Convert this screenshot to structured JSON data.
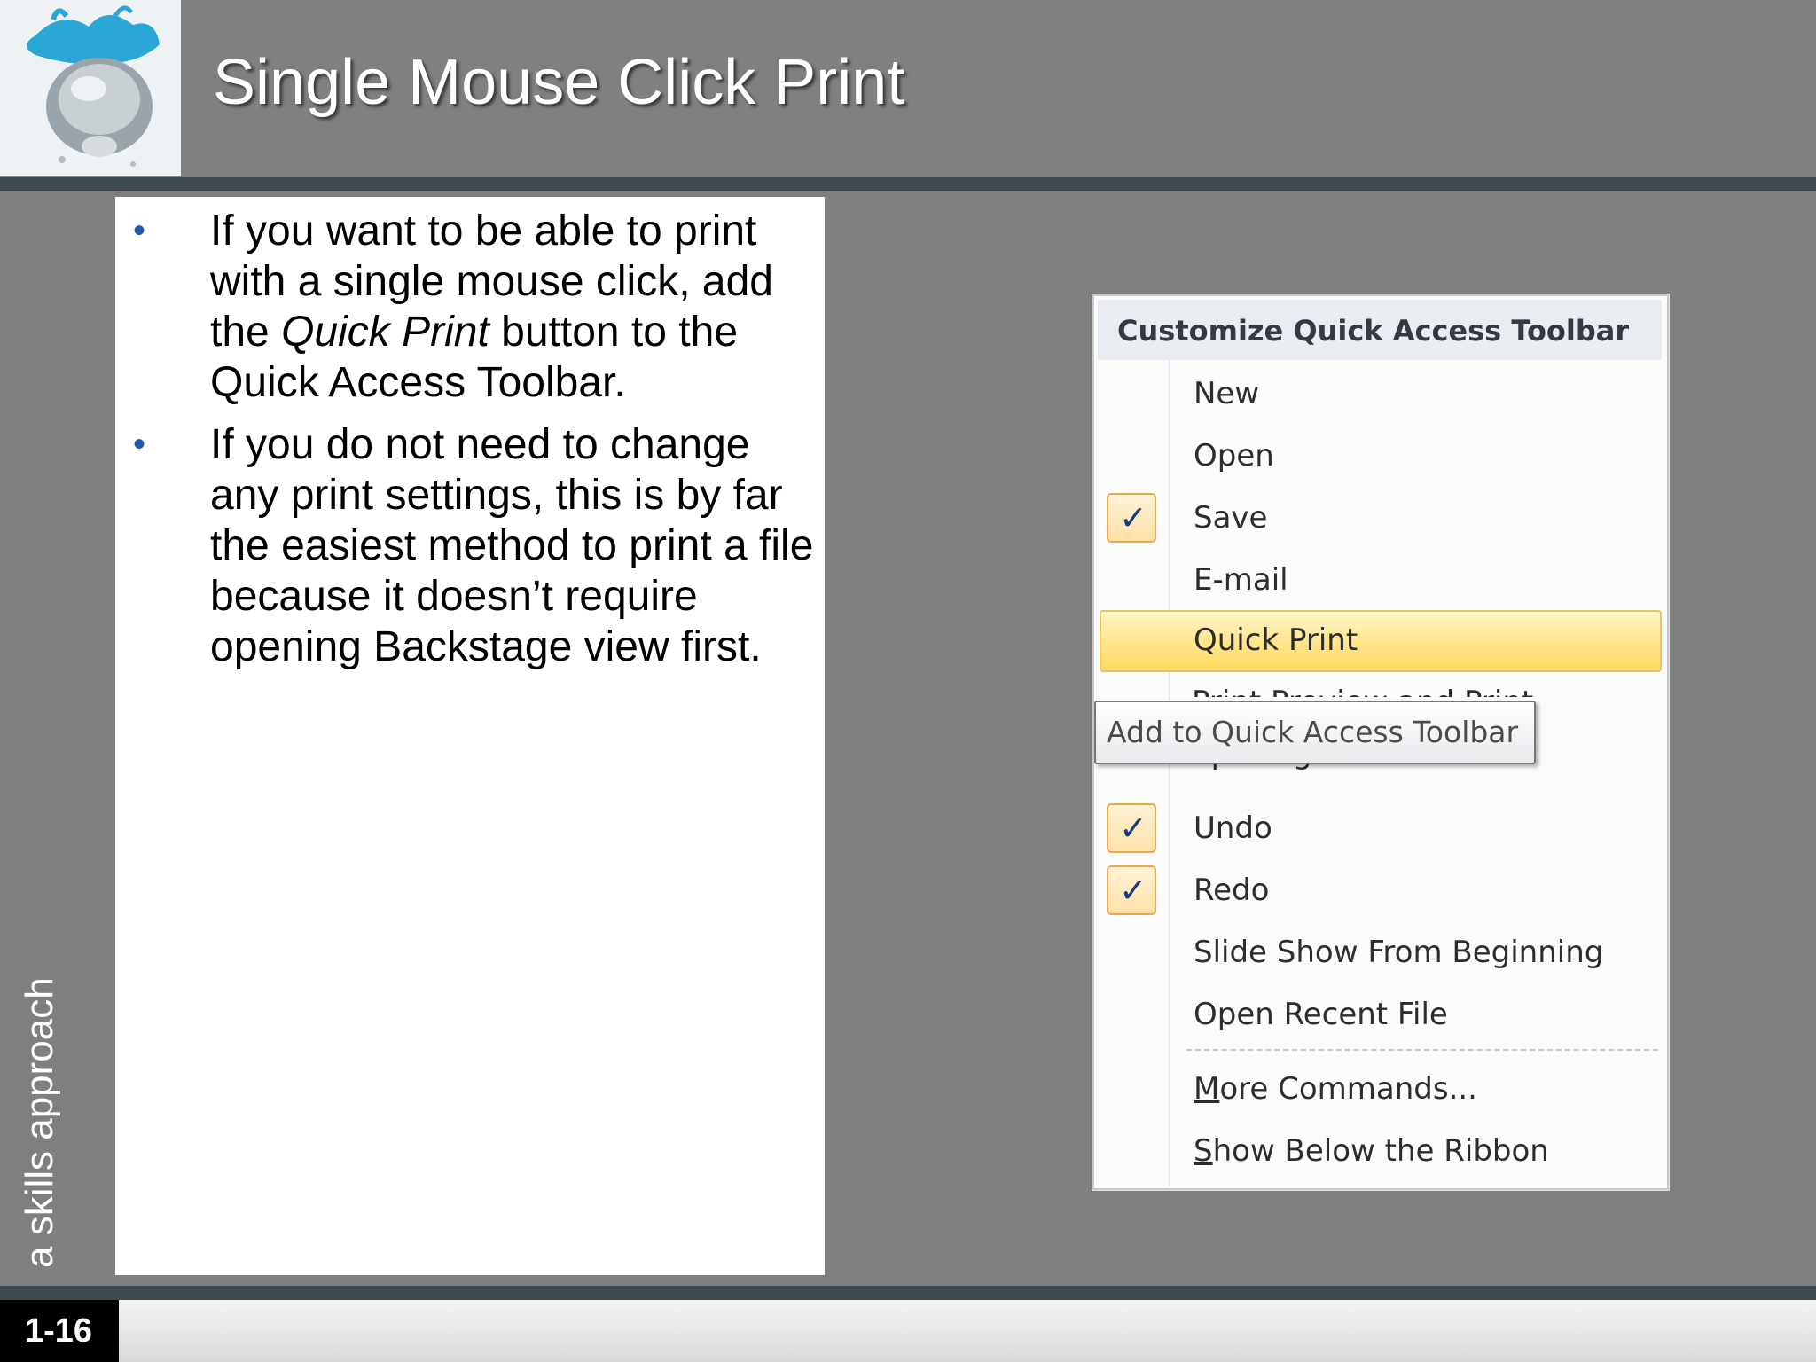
{
  "slide": {
    "title": "Single Mouse Click Print",
    "side_text": "a skills approach",
    "slide_number": "1-16"
  },
  "bullets": [
    {
      "pre": "If you want to be able to print with a single mouse click, add the ",
      "em": "Quick Print",
      "post": " button to the Quick Access Toolbar."
    },
    {
      "pre": "If you do not need to change any print settings, this is by far the easiest method to print a file because it doesn’t require opening Backstage view first.",
      "em": "",
      "post": ""
    }
  ],
  "menu": {
    "header": "Customize Quick Access Toolbar",
    "items": [
      {
        "label": "New",
        "checked": false
      },
      {
        "label": "Open",
        "checked": false
      },
      {
        "label": "Save",
        "checked": true
      },
      {
        "label": "E-mail",
        "checked": false
      },
      {
        "label": "Quick Print",
        "checked": false,
        "highlighted": true
      },
      {
        "label": "Print Preview and Print",
        "checked": false,
        "obscured": true
      },
      {
        "label": "Spelling",
        "checked": false,
        "obscured": true
      },
      {
        "label": "Undo",
        "checked": true
      },
      {
        "label": "Redo",
        "checked": true
      },
      {
        "label": "Slide Show From Beginning",
        "checked": false
      },
      {
        "label": "Open Recent File",
        "checked": false
      }
    ],
    "footer_items": [
      {
        "label": "More Commands..."
      },
      {
        "label": "Show Below the Ribbon"
      }
    ]
  },
  "tooltip": "Add to Quick Access Toolbar",
  "icons": {
    "logo": "water-splash-logo",
    "check": "check-icon"
  },
  "colors": {
    "background": "#7f7f81",
    "band": "#3f4a51",
    "bullet": "#1f5aa6",
    "highlight": "#ffe58a"
  }
}
